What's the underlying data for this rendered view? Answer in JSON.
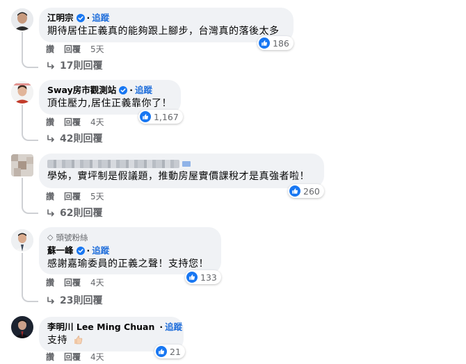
{
  "follow_label": "追蹤",
  "actions": {
    "like": "讚",
    "reply": "回覆"
  },
  "comments": [
    {
      "author": "江明宗",
      "text": "期待居住正義真的能夠跟上腳步，台灣真的落後太多",
      "reactions": "186",
      "time": "5天",
      "replies": "17則回覆"
    },
    {
      "author": "Sway房市觀測站",
      "text": "頂住壓力,居住正義靠你了！",
      "reactions": "1,167",
      "time": "4天",
      "replies": "42則回覆"
    },
    {
      "author": "",
      "text": "學姊，實坪制是假議題，推動房屋實價課稅才是真強者啦！",
      "reactions": "260",
      "time": "5天",
      "replies": "62則回覆"
    },
    {
      "badge": "頭號粉絲",
      "author": "蘇一峰",
      "text": "感謝嘉瑜委員的正義之聲！支持您！",
      "reactions": "133",
      "time": "4天",
      "replies": "23則回覆"
    },
    {
      "author": "李明川 Lee Ming Chuan",
      "text": "支持",
      "reactions": "21",
      "time": "4天"
    }
  ],
  "colors": {
    "like_blue": "#1877f2",
    "bubble": "#f0f2f5",
    "link": "#216fdb",
    "muted": "#65676b"
  }
}
